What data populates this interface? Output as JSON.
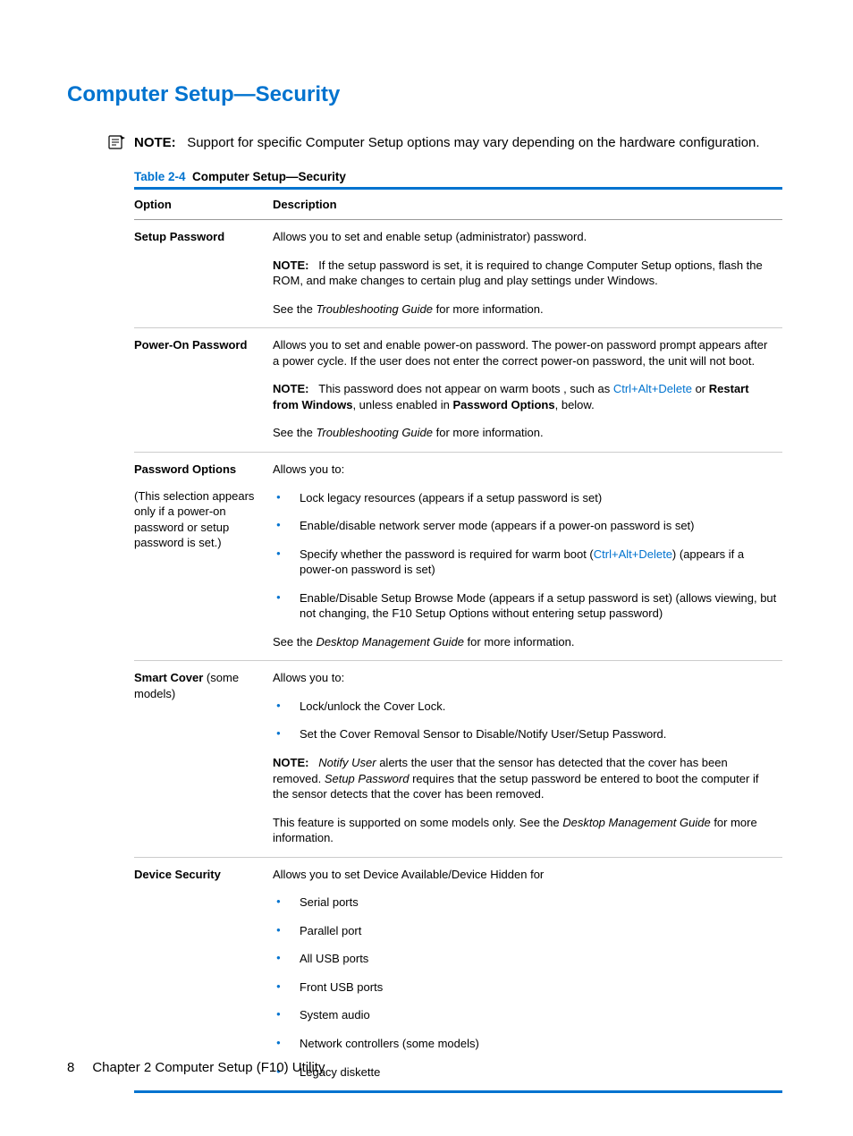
{
  "page_title": "Computer Setup—Security",
  "top_note": {
    "label": "NOTE:",
    "text_before": "Support for specific Computer Setup options may vary depending on the hardware configuration."
  },
  "table": {
    "caption_prefix": "Table 2-4",
    "caption_title": "Computer Setup—Security",
    "headers": {
      "option": "Option",
      "description": "Description"
    },
    "rows": {
      "setup_password": {
        "option": "Setup Password",
        "p1": "Allows you to set and enable setup (administrator) password.",
        "note_label": "NOTE:",
        "note_text": "If the setup password is set, it is required to change Computer Setup options, flash the ROM, and make changes to certain plug and play settings under Windows.",
        "p3_before": "See the ",
        "p3_italic": "Troubleshooting Guide",
        "p3_after": " for more information."
      },
      "power_on_password": {
        "option": "Power-On Password",
        "p1": "Allows you to set and enable power-on password. The power-on password prompt appears after a power cycle. If the user does not enter the correct power-on password, the unit will not boot.",
        "note_label": "NOTE:",
        "note_before": "This password does not appear on warm boots , such as ",
        "key1": "Ctrl",
        "plus1": "+",
        "key2": "Alt",
        "plus2": "+",
        "key3": "Delete",
        "note_mid": " or ",
        "bold1": "Restart from Windows",
        "note_mid2": ", unless enabled in ",
        "bold2": "Password Options",
        "note_after": ", below.",
        "p3_before": "See the ",
        "p3_italic": "Troubleshooting Guide",
        "p3_after": " for more information."
      },
      "password_options": {
        "option": "Password Options",
        "option_sub": "(This selection appears only if a power-on password or setup password is set.)",
        "p1": "Allows you to:",
        "b1": "Lock legacy resources (appears if a setup password is set)",
        "b2": "Enable/disable network server mode (appears if a power-on password is set)",
        "b3_before": "Specify whether the password is required for warm boot (",
        "b3_k1": "Ctrl",
        "b3_p1": "+",
        "b3_k2": "Alt",
        "b3_p2": "+",
        "b3_k3": "Delete",
        "b3_after": ") (appears if a power-on password is set)",
        "b4": "Enable/Disable Setup Browse Mode (appears if a setup password is set) (allows viewing, but not changing, the F10 Setup Options without entering setup password)",
        "p3_before": "See the ",
        "p3_italic": "Desktop Management Guide",
        "p3_after": " for more information."
      },
      "smart_cover": {
        "option_bold": "Smart Cover",
        "option_tail": " (some models)",
        "p1": "Allows you to:",
        "b1": "Lock/unlock the Cover Lock.",
        "b2": "Set the Cover Removal Sensor to Disable/Notify User/Setup Password.",
        "note_label": "NOTE:",
        "note_i1": "Notify User",
        "note_mid1": " alerts the user that the sensor has detected that the cover has been removed. ",
        "note_i2": "Setup Password",
        "note_mid2": " requires that the setup password be entered to boot the computer if the sensor detects that the cover has been removed.",
        "p4_before": "This feature is supported on some models only. See the ",
        "p4_italic": "Desktop Management Guide",
        "p4_after": " for more information."
      },
      "device_security": {
        "option": "Device Security",
        "p1": "Allows you to set Device Available/Device Hidden for",
        "b1": "Serial ports",
        "b2": "Parallel port",
        "b3": "All USB ports",
        "b4": "Front USB ports",
        "b5": "System audio",
        "b6": "Network controllers (some models)",
        "b7": "Legacy diskette"
      }
    }
  },
  "footer": {
    "pagenum": "8",
    "chapter": "Chapter 2   Computer Setup (F10) Utility"
  }
}
